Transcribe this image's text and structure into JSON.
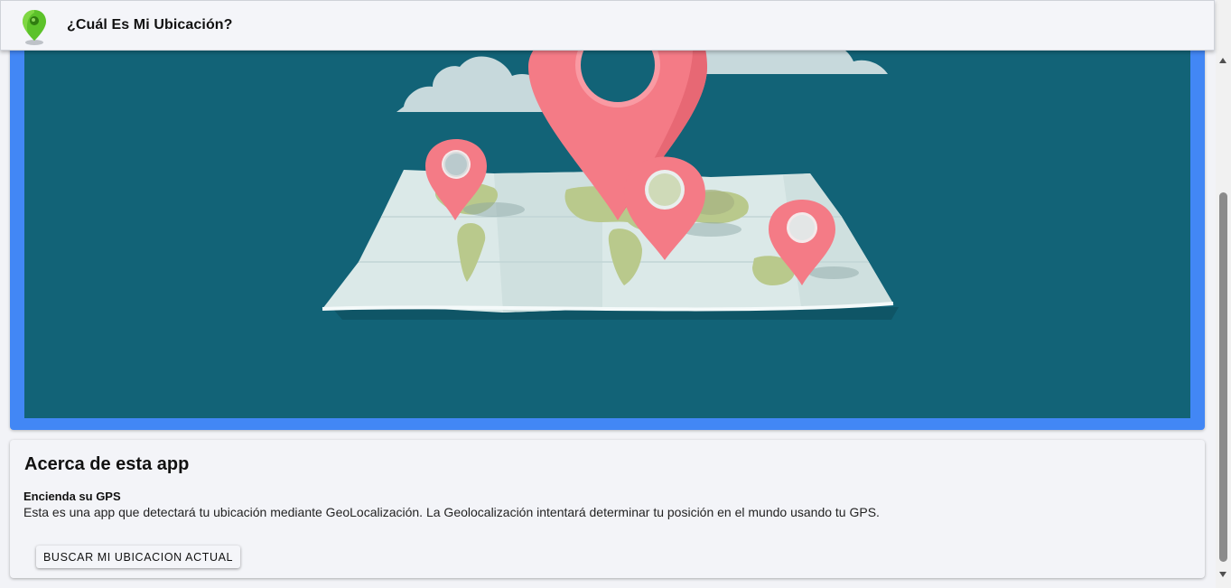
{
  "header": {
    "title": "¿Cuál Es Mi Ubicación?",
    "logo_icon": "map-pin-logo-icon"
  },
  "hero": {
    "image_icon": "world-map-with-pins-illustration",
    "colors": {
      "frame": "#4287f5",
      "background": "#126377",
      "pin": "#f47b86",
      "map": "#dbe9e8",
      "land": "#b9c98c"
    }
  },
  "about": {
    "heading": "Acerca de esta app",
    "subtitle": "Encienda su GPS",
    "text": "Esta es una app que detectará tu ubicación mediante GeoLocalización. La Geolocalización intentará determinar tu posición en el mundo usando tu GPS.",
    "button_label": "BUSCAR MI UBICACION ACTUAL"
  }
}
